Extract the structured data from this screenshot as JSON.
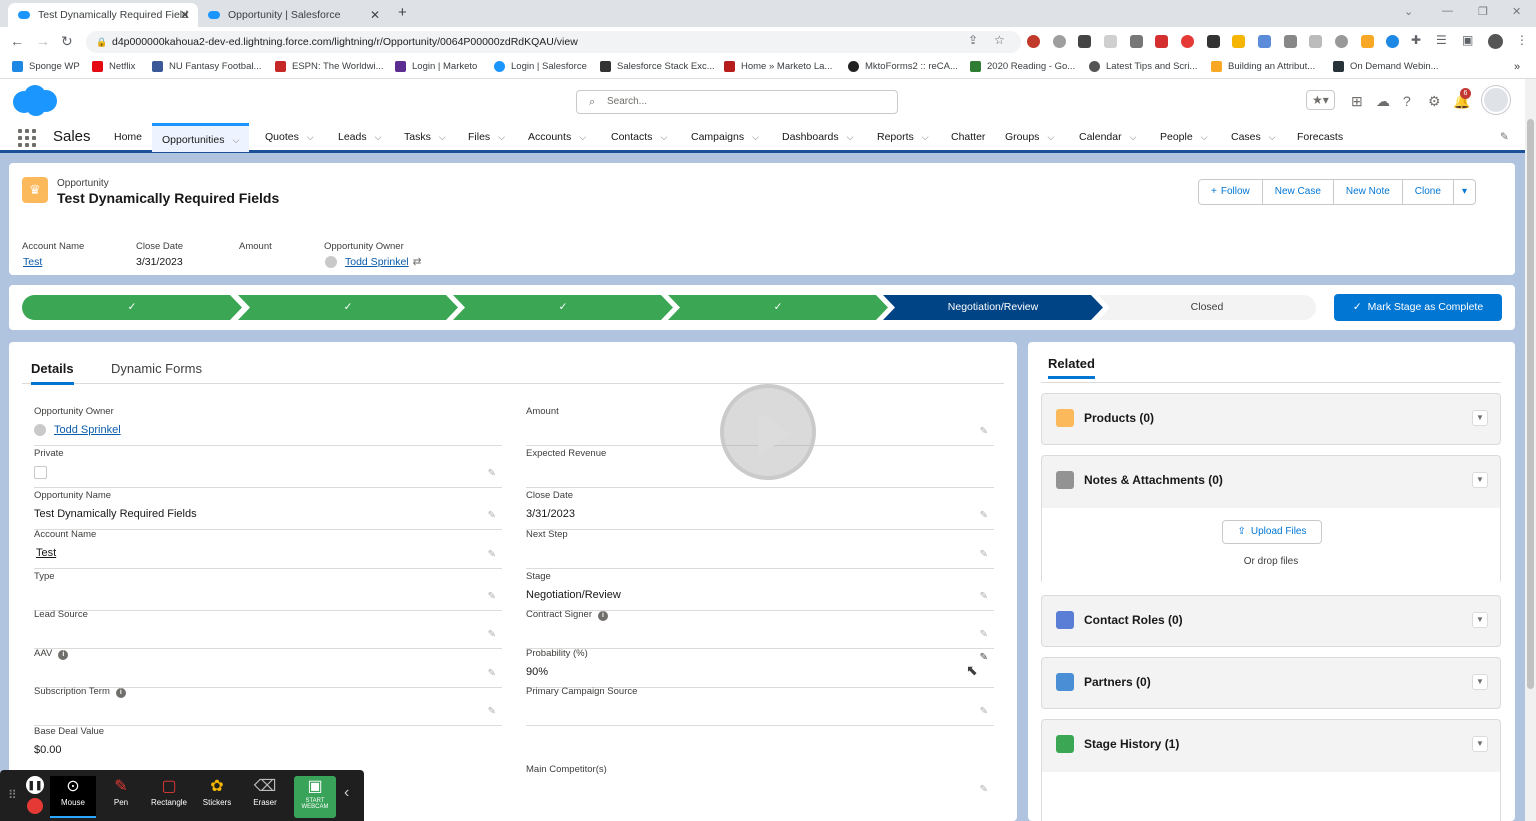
{
  "browser": {
    "tabs": [
      {
        "title": "Test Dynamically Required Field",
        "active": true
      },
      {
        "title": "Opportunity | Salesforce",
        "active": false
      }
    ],
    "url": "d4p000000kahoua2-dev-ed.lightning.force.com/lightning/r/Opportunity/0064P00000zdRdKQAU/view",
    "bookmarks": [
      "Sponge WP",
      "Netflix",
      "NU Fantasy Footbal...",
      "ESPN: The Worldwi...",
      "Login | Marketo",
      "Login | Salesforce",
      "Salesforce Stack Exc...",
      "Home » Marketo La...",
      "MktoForms2 :: reCA...",
      "2020 Reading - Go...",
      "Latest Tips and Scri...",
      "Building an Attribut...",
      "On Demand Webin..."
    ]
  },
  "header": {
    "search_placeholder": "Search...",
    "notification_count": "6"
  },
  "nav": {
    "app_name": "Sales",
    "items": [
      "Home",
      "Opportunities",
      "Quotes",
      "Leads",
      "Tasks",
      "Files",
      "Accounts",
      "Contacts",
      "Campaigns",
      "Dashboards",
      "Reports",
      "Chatter",
      "Groups",
      "Calendar",
      "People",
      "Cases",
      "Forecasts"
    ]
  },
  "record": {
    "object_label": "Opportunity",
    "title": "Test Dynamically Required Fields",
    "actions": [
      "Follow",
      "New Case",
      "New Note",
      "Clone"
    ],
    "highlights": [
      {
        "label": "Account Name",
        "value": "Test"
      },
      {
        "label": "Close Date",
        "value": "3/31/2023"
      },
      {
        "label": "Amount",
        "value": ""
      },
      {
        "label": "Opportunity Owner",
        "value": "Todd Sprinkel"
      }
    ]
  },
  "path": {
    "stages": [
      {
        "label": "✓",
        "state": "done"
      },
      {
        "label": "✓",
        "state": "done"
      },
      {
        "label": "✓",
        "state": "done"
      },
      {
        "label": "✓",
        "state": "done"
      },
      {
        "label": "Negotiation/Review",
        "state": "current"
      },
      {
        "label": "Closed",
        "state": "todo"
      }
    ],
    "mark_button": "Mark Stage as Complete"
  },
  "details": {
    "tabs": [
      "Details",
      "Dynamic Forms"
    ],
    "left": [
      {
        "label": "Opportunity Owner",
        "value": "Todd Sprinkel"
      },
      {
        "label": "Private",
        "value": ""
      },
      {
        "label": "Opportunity Name",
        "value": "Test Dynamically Required Fields"
      },
      {
        "label": "Account Name",
        "value": "Test"
      },
      {
        "label": "Type",
        "value": ""
      },
      {
        "label": "Lead Source",
        "value": ""
      },
      {
        "label": "AAV",
        "value": ""
      },
      {
        "label": "Subscription Term",
        "value": ""
      },
      {
        "label": "Base Deal Value",
        "value": "$0.00"
      }
    ],
    "right": [
      {
        "label": "Amount",
        "value": ""
      },
      {
        "label": "Expected Revenue",
        "value": ""
      },
      {
        "label": "Close Date",
        "value": "3/31/2023"
      },
      {
        "label": "Next Step",
        "value": ""
      },
      {
        "label": "Stage",
        "value": "Negotiation/Review"
      },
      {
        "label": "Contract Signer",
        "value": ""
      },
      {
        "label": "Probability (%)",
        "value": "90%"
      },
      {
        "label": "Primary Campaign Source",
        "value": ""
      },
      {
        "label": "",
        "value": ""
      },
      {
        "label": "Main Competitor(s)",
        "value": ""
      }
    ]
  },
  "related": {
    "title": "Related",
    "items": [
      "Products (0)",
      "Notes & Attachments (0)",
      "Contact Roles (0)",
      "Partners (0)",
      "Stage History (1)"
    ],
    "upload_button": "Upload Files",
    "drop_text": "Or drop files"
  },
  "recorder": {
    "tools": [
      "Mouse",
      "Pen",
      "Rectangle",
      "Stickers",
      "Eraser",
      "START WEBCAM"
    ]
  },
  "colors": {
    "brand_blue": "#0176d3",
    "path_done": "#3ba755",
    "path_current": "#014486",
    "nav_band": "#1b5297",
    "page_bg": "#b0c4df"
  }
}
